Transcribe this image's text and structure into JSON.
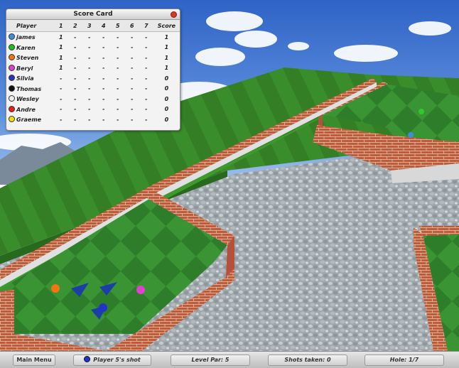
{
  "scorecard": {
    "title": "Score Card",
    "headers": [
      "Player",
      "1",
      "2",
      "3",
      "4",
      "5",
      "6",
      "7",
      "Score"
    ],
    "players": [
      {
        "name": "james",
        "color": "#3a8de0",
        "holes": [
          "1",
          "-",
          "-",
          "-",
          "-",
          "-",
          "-"
        ],
        "score": "1"
      },
      {
        "name": "Karen",
        "color": "#22bb22",
        "holes": [
          "1",
          "-",
          "-",
          "-",
          "-",
          "-",
          "-"
        ],
        "score": "1"
      },
      {
        "name": "Steven",
        "color": "#ee7711",
        "holes": [
          "1",
          "-",
          "-",
          "-",
          "-",
          "-",
          "-"
        ],
        "score": "1"
      },
      {
        "name": "Beryl",
        "color": "#dd44cc",
        "holes": [
          "1",
          "-",
          "-",
          "-",
          "-",
          "-",
          "-"
        ],
        "score": "1"
      },
      {
        "name": "Silvia",
        "color": "#2233cc",
        "holes": [
          "-",
          "-",
          "-",
          "-",
          "-",
          "-",
          "-"
        ],
        "score": "0"
      },
      {
        "name": "Thomas",
        "color": "#111111",
        "holes": [
          "-",
          "-",
          "-",
          "-",
          "-",
          "-",
          "-"
        ],
        "score": "0"
      },
      {
        "name": "Wesley",
        "color": "#eeeeee",
        "holes": [
          "-",
          "-",
          "-",
          "-",
          "-",
          "-",
          "-"
        ],
        "score": "0"
      },
      {
        "name": "Andre",
        "color": "#dd2222",
        "holes": [
          "-",
          "-",
          "-",
          "-",
          "-",
          "-",
          "-"
        ],
        "score": "0"
      },
      {
        "name": "Graeme",
        "color": "#eedd11",
        "holes": [
          "-",
          "-",
          "-",
          "-",
          "-",
          "-",
          "-"
        ],
        "score": "0"
      }
    ]
  },
  "bottombar": {
    "main_menu": "Main Menu",
    "status": "Player 5's shot",
    "level_par": "Level Par: 5",
    "shots_taken": "Shots taken: 0",
    "hole": "Hole: 1/7"
  }
}
